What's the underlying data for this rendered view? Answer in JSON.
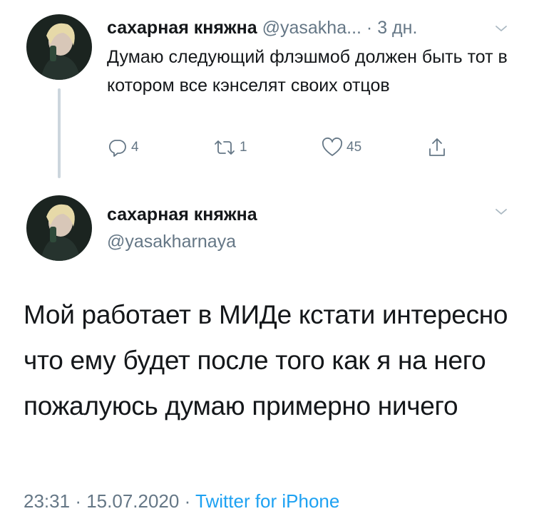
{
  "parent_tweet": {
    "author_name": "сахарная княжна",
    "author_handle": "@yasakha...",
    "separator": "·",
    "time_ago": "3 дн.",
    "text": "Думаю следующий флэшмоб должен быть тот в котором все кэнселят своих отцов",
    "actions": {
      "reply_count": "4",
      "retweet_count": "1",
      "like_count": "45"
    }
  },
  "main_tweet": {
    "author_name": "сахарная княжна",
    "author_handle": "@yasakharnaya",
    "text": "Мой работает в МИДе кстати интересно что ему будет после того как я на него пожалуюсь думаю примерно ничего",
    "time": "23:31",
    "date": "15.07.2020",
    "separator": "·",
    "source": "Twitter for iPhone"
  },
  "icons": {
    "reply": "reply-icon",
    "retweet": "retweet-icon",
    "like": "heart-icon",
    "share": "share-icon",
    "caret": "chevron-down-icon"
  },
  "colors": {
    "text_primary": "#14171a",
    "text_secondary": "#657786",
    "link": "#1da1f2",
    "thread_line": "#ccd6dd"
  }
}
